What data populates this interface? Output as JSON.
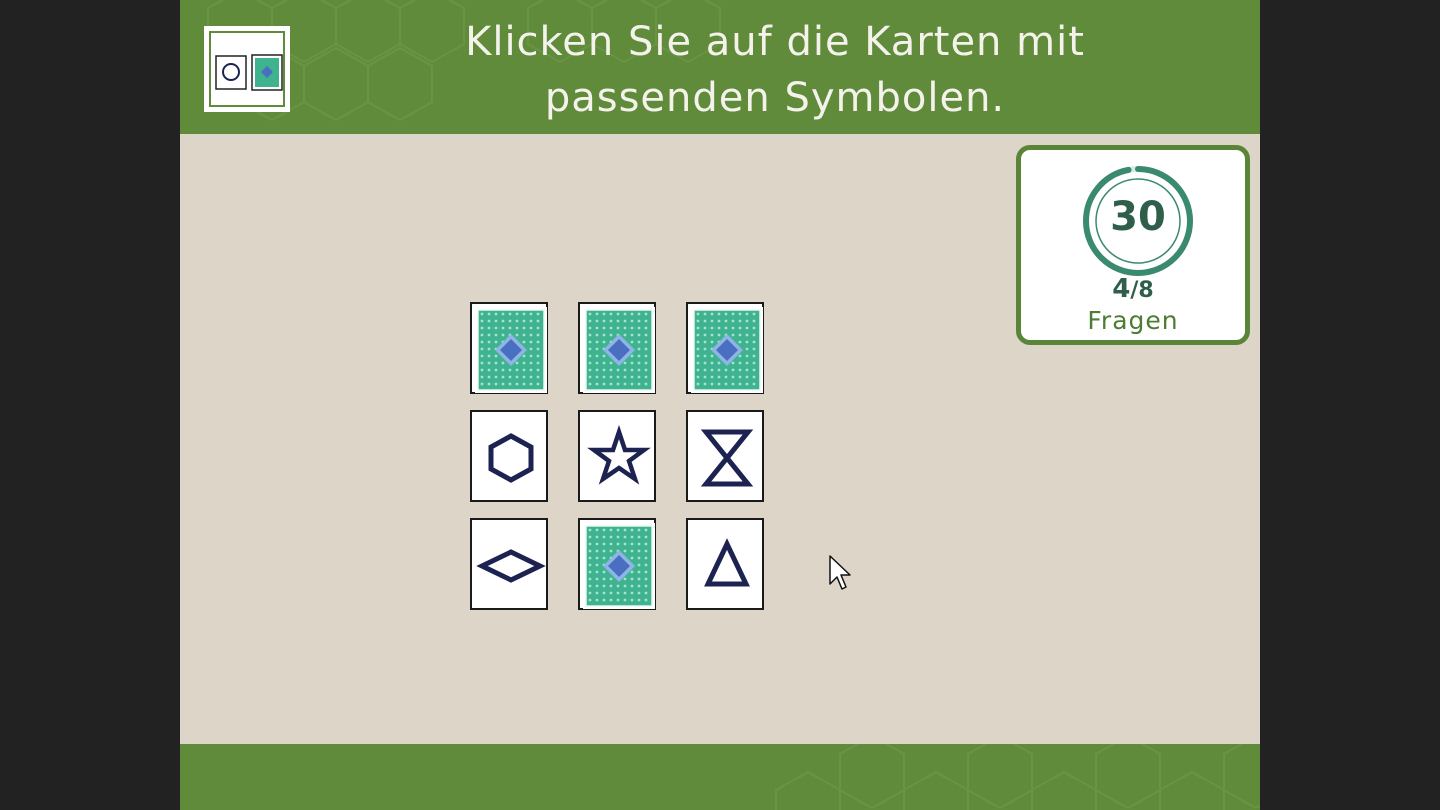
{
  "header": {
    "instruction_line1": "Klicken Sie auf die Karten mit",
    "instruction_line2": "passenden Symbolen."
  },
  "status": {
    "timer": "30",
    "progress_current": "4",
    "progress_separator": "/",
    "progress_total": "8",
    "progress_label": "Fragen",
    "timer_fraction_remaining": 0.97
  },
  "cards": [
    {
      "state": "face-down",
      "symbol": "card-back"
    },
    {
      "state": "face-down",
      "symbol": "card-back"
    },
    {
      "state": "face-down",
      "symbol": "card-back"
    },
    {
      "state": "face-up",
      "symbol": "hexagon"
    },
    {
      "state": "face-up",
      "symbol": "star"
    },
    {
      "state": "face-up",
      "symbol": "hourglass"
    },
    {
      "state": "face-up",
      "symbol": "diamond"
    },
    {
      "state": "face-down",
      "symbol": "card-back"
    },
    {
      "state": "face-up",
      "symbol": "triangle"
    }
  ],
  "colors": {
    "header_green": "#5f8b3b",
    "board_beige": "#ddd6c8",
    "card_back_teal": "#3fb38f",
    "card_back_diamond": "#4a6fc0",
    "symbol_navy": "#1c2350",
    "timer_ring": "#3a8a6e"
  }
}
